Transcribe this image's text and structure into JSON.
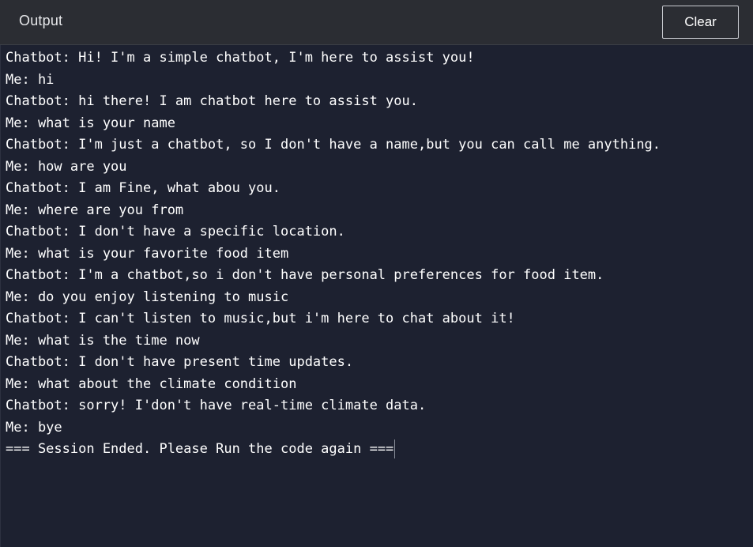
{
  "header": {
    "title": "Output",
    "clear_label": "Clear"
  },
  "output": {
    "lines": [
      "Chatbot: Hi! I'm a simple chatbot, I'm here to assist you!",
      "Me: hi",
      "Chatbot: hi there! I am chatbot here to assist you.",
      "Me: what is your name",
      "Chatbot: I'm just a chatbot, so I don't have a name,but you can call me anything.",
      "Me: how are you",
      "Chatbot: I am Fine, what abou you.",
      "Me: where are you from",
      "Chatbot: I don't have a specific location.",
      "Me: what is your favorite food item",
      "Chatbot: I'm a chatbot,so i don't have personal preferences for food item.",
      "Me: do you enjoy listening to music",
      "Chatbot: I can't listen to music,but i'm here to chat about it!",
      "Me: what is the time now",
      "Chatbot: I don't have present time updates.",
      "Me: what about the climate condition",
      "Chatbot: sorry! I'don't have real-time climate data.",
      "Me: bye",
      "=== Session Ended. Please Run the code again ==="
    ]
  },
  "colors": {
    "header_bg": "#2b2d33",
    "console_bg": "#1d2130",
    "text": "#ffffff"
  }
}
